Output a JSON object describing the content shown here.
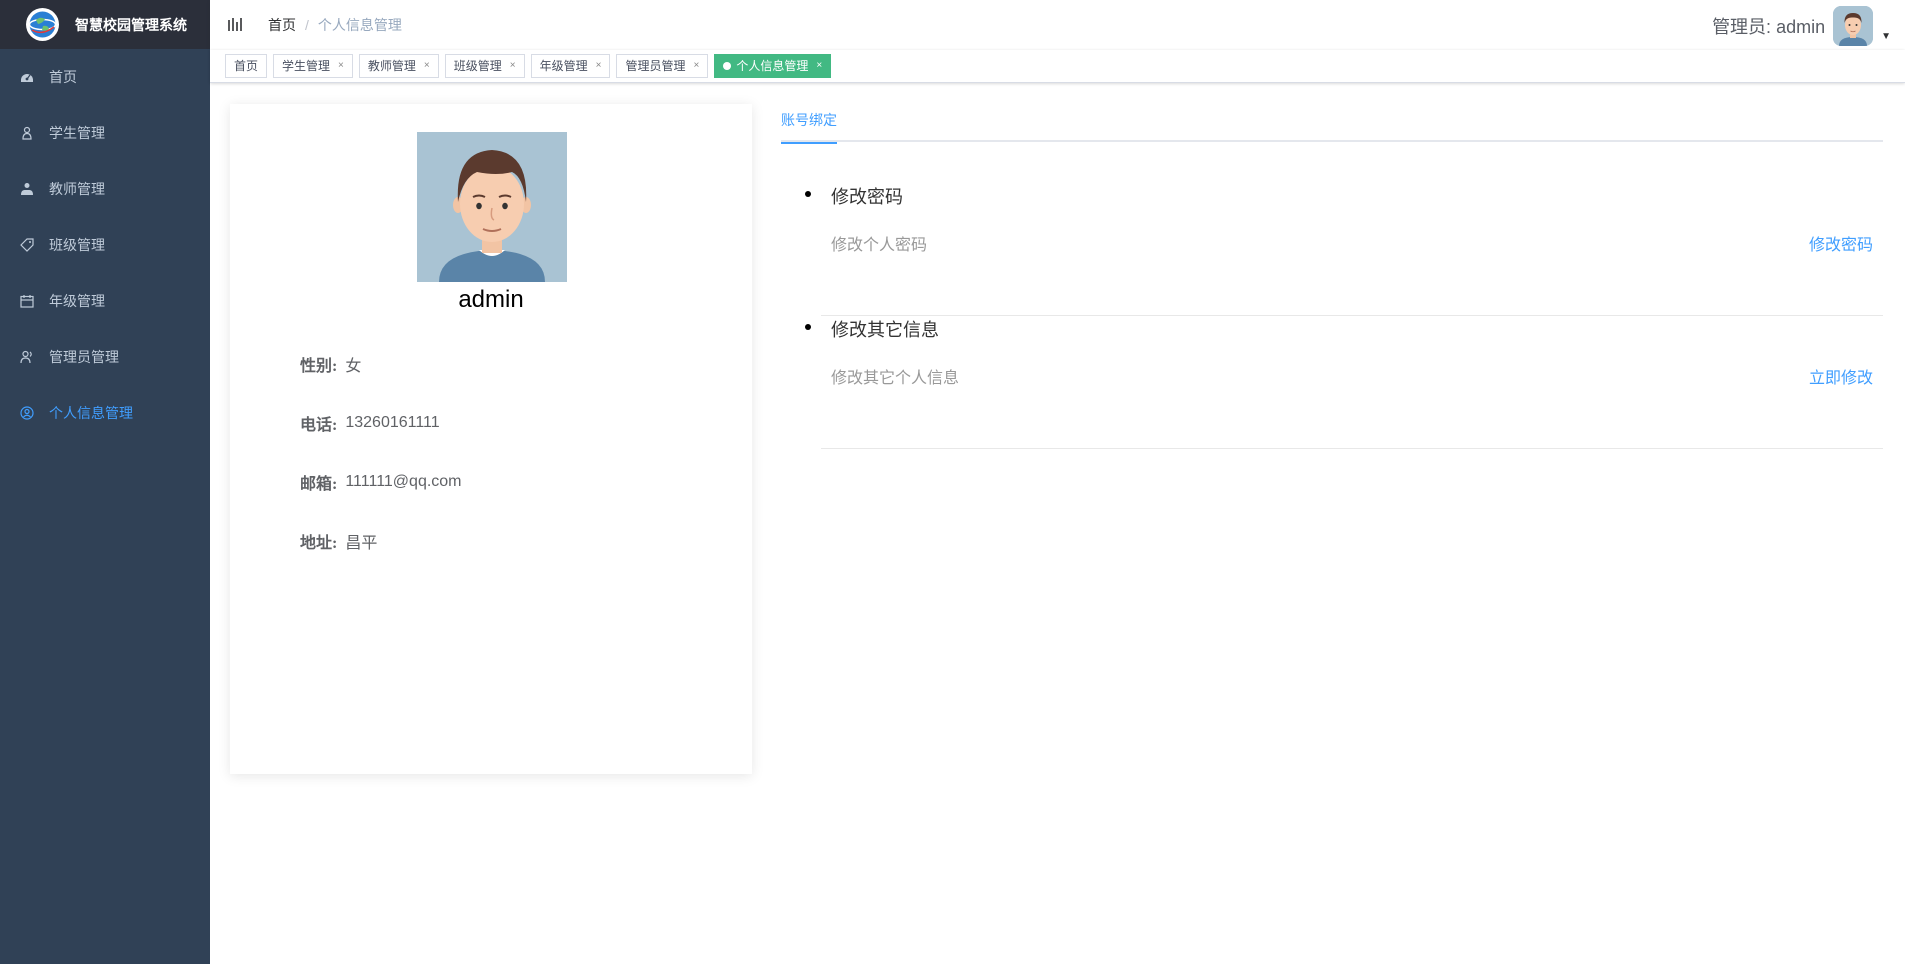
{
  "app": {
    "title": "智慧校园管理系统"
  },
  "sidebar": {
    "items": [
      {
        "label": "首页",
        "icon": "dashboard-icon"
      },
      {
        "label": "学生管理",
        "icon": "user-icon"
      },
      {
        "label": "教师管理",
        "icon": "peoples-icon"
      },
      {
        "label": "班级管理",
        "icon": "tag-icon"
      },
      {
        "label": "年级管理",
        "icon": "calendar-icon"
      },
      {
        "label": "管理员管理",
        "icon": "admin-icon"
      },
      {
        "label": "个人信息管理",
        "icon": "profile-icon",
        "active": true
      }
    ]
  },
  "header": {
    "breadcrumb_home": "首页",
    "breadcrumb_sep": "/",
    "breadcrumb_current": "个人信息管理",
    "user_label": "管理员: admin"
  },
  "tags": {
    "items": [
      {
        "label": "首页",
        "closable": false
      },
      {
        "label": "学生管理",
        "closable": true
      },
      {
        "label": "教师管理",
        "closable": true
      },
      {
        "label": "班级管理",
        "closable": true
      },
      {
        "label": "年级管理",
        "closable": true
      },
      {
        "label": "管理员管理",
        "closable": true
      },
      {
        "label": "个人信息管理",
        "closable": true,
        "active": true
      }
    ],
    "close_glyph": "×"
  },
  "profile": {
    "name": "admin",
    "fields": [
      {
        "key": "性别:",
        "value": "女"
      },
      {
        "key": "电话:",
        "value": "13260161111"
      },
      {
        "key": "邮箱:",
        "value": "111111@qq.com"
      },
      {
        "key": "地址:",
        "value": "昌平"
      }
    ]
  },
  "settings": {
    "tab_label": "账号绑定",
    "items": [
      {
        "title": "修改密码",
        "desc": "修改个人密码",
        "action": "修改密码"
      },
      {
        "title": "修改其它信息",
        "desc": "修改其它个人信息",
        "action": "立即修改"
      }
    ]
  },
  "colors": {
    "sidebar_bg": "#304156",
    "logo_bg": "#2b2f3a",
    "accent": "#409eff",
    "tag_active": "#42b983"
  }
}
